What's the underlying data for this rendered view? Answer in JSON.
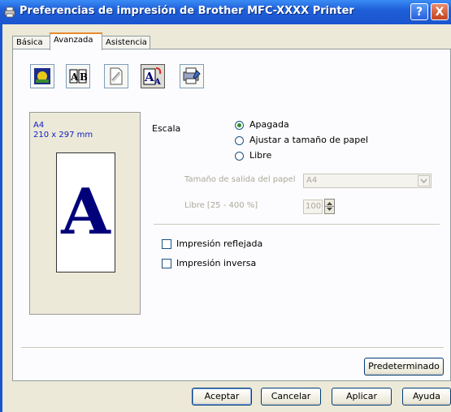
{
  "window": {
    "title": "Preferencias de impresión de Brother MFC-XXXX Printer",
    "help_button": "?",
    "close_button": "X",
    "title_icon": "printer-icon"
  },
  "tabs": [
    {
      "label": "Básica"
    },
    {
      "label": "Avanzada",
      "active": true
    },
    {
      "label": "Asistencia"
    }
  ],
  "toolbar": {
    "icons": [
      "color-settings-icon",
      "duplex-booklet-icon",
      "watermark-icon",
      "scaling-icon",
      "other-print-options-icon"
    ],
    "active_index": 3
  },
  "preview": {
    "paper": "A4",
    "dimensions": "210 x 297 mm",
    "glyph": "A"
  },
  "scaling": {
    "label": "Escala",
    "options": [
      {
        "label": "Apagada",
        "selected": true
      },
      {
        "label": "Ajustar a tamaño de papel",
        "selected": false
      },
      {
        "label": "Libre",
        "selected": false
      }
    ],
    "output_paper_label": "Tamaño de salida del papel",
    "output_paper_value": "A4",
    "free_label": "Libre [25 - 400 %]",
    "free_value": "100"
  },
  "options": {
    "mirror_label": "Impresión reflejada",
    "mirror_checked": false,
    "reverse_label": "Impresión inversa",
    "reverse_checked": false
  },
  "buttons": {
    "default": "Predeterminado",
    "ok": "Aceptar",
    "cancel": "Cancelar",
    "apply": "Aplicar",
    "help": "Ayuda"
  }
}
